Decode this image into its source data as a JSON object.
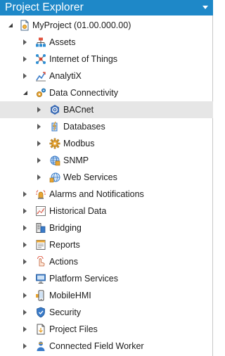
{
  "panel": {
    "title": "Project Explorer"
  },
  "tree": {
    "root": {
      "label": "MyProject (01.00.000.00)",
      "icon": "project-icon"
    },
    "items": [
      {
        "label": "Assets",
        "icon": "assets-icon"
      },
      {
        "label": "Internet of Things",
        "icon": "iot-icon"
      },
      {
        "label": "AnalytiX",
        "icon": "analytix-icon"
      },
      {
        "label": "Data Connectivity",
        "icon": "data-connectivity-icon"
      },
      {
        "label": "Alarms and Notifications",
        "icon": "alarm-icon"
      },
      {
        "label": "Historical Data",
        "icon": "historical-data-icon"
      },
      {
        "label": "Bridging",
        "icon": "bridging-icon"
      },
      {
        "label": "Reports",
        "icon": "reports-icon"
      },
      {
        "label": "Actions",
        "icon": "actions-icon"
      },
      {
        "label": "Platform Services",
        "icon": "platform-services-icon"
      },
      {
        "label": "MobileHMI",
        "icon": "mobile-hmi-icon"
      },
      {
        "label": "Security",
        "icon": "security-icon"
      },
      {
        "label": "Project Files",
        "icon": "project-files-icon"
      },
      {
        "label": "Connected Field Worker",
        "icon": "connected-field-worker-icon"
      }
    ],
    "data_connectivity_children": [
      {
        "label": "BACnet",
        "icon": "bacnet-icon",
        "selected": true
      },
      {
        "label": "Databases",
        "icon": "databases-icon"
      },
      {
        "label": "Modbus",
        "icon": "modbus-icon"
      },
      {
        "label": "SNMP",
        "icon": "snmp-icon"
      },
      {
        "label": "Web Services",
        "icon": "web-services-icon"
      }
    ]
  },
  "colors": {
    "title_bar": "#1e88c8",
    "selected_row": "#e6e6e6"
  }
}
